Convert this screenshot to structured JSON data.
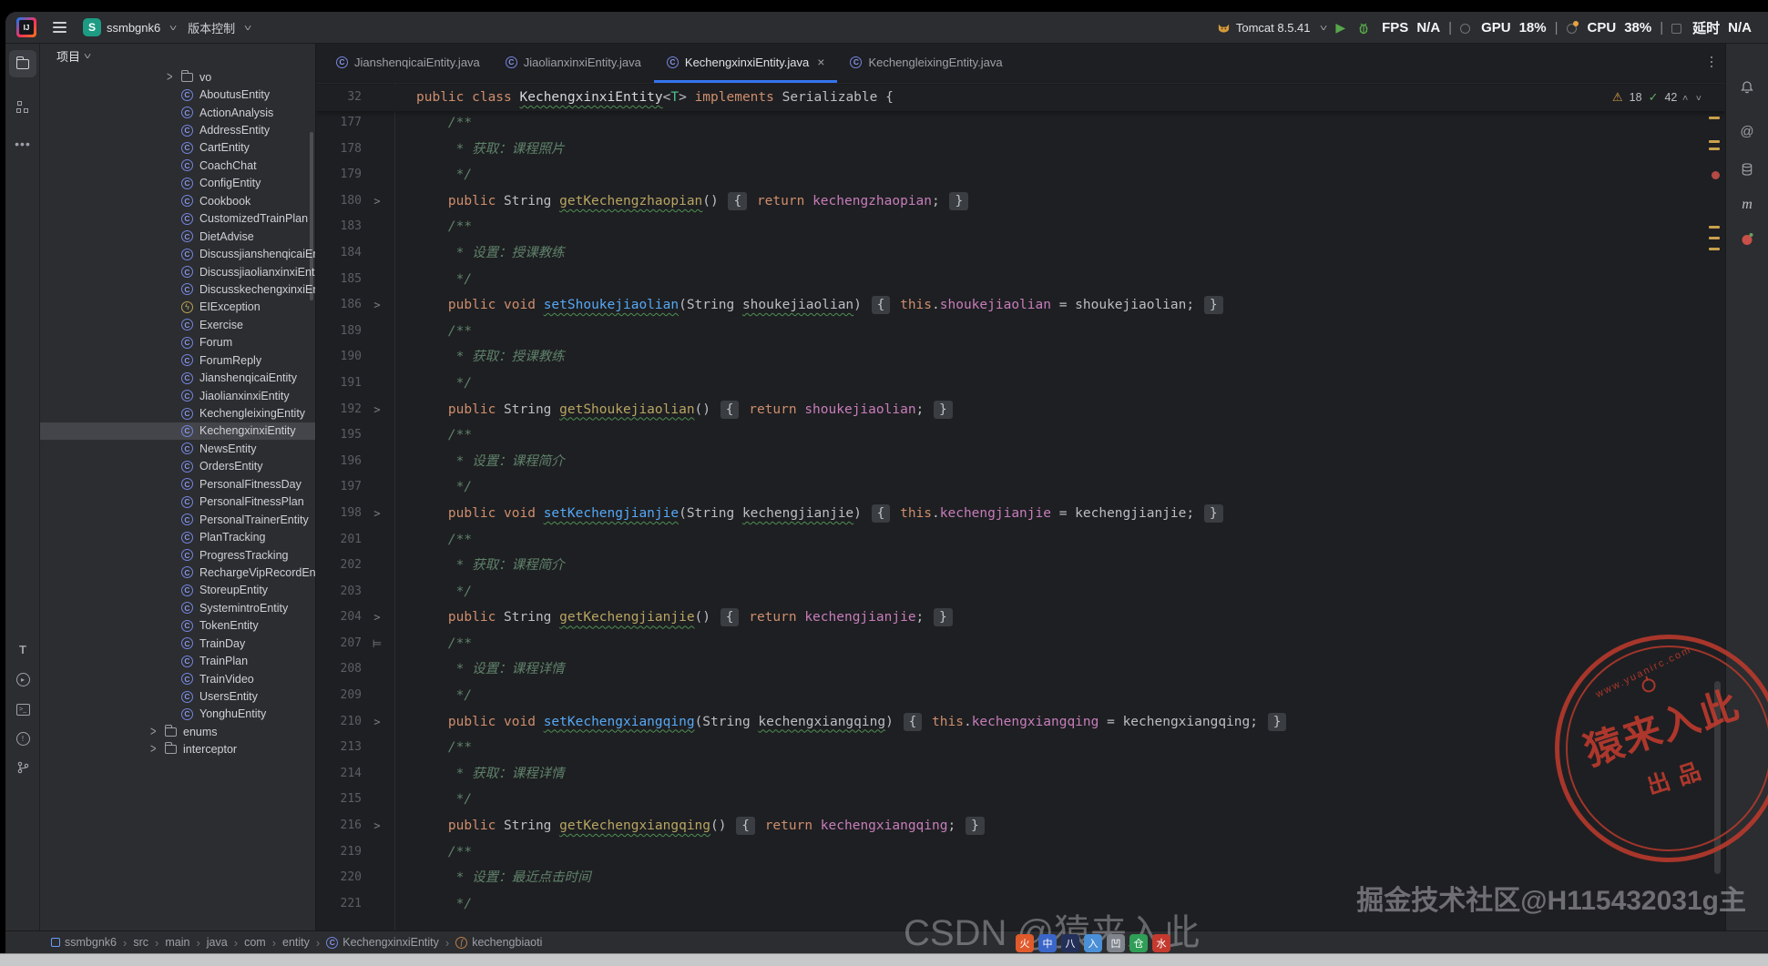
{
  "toolbar": {
    "app": "IntelliJ IDEA",
    "logo_text": "IJ",
    "project_avatar": "S",
    "project_name": "ssmbgnk6",
    "vcs_menu": "版本控制",
    "run_config": "Tomcat 8.5.41",
    "overlay_stats": [
      {
        "label": "FPS",
        "value": "N/A",
        "icon": ""
      },
      {
        "label": "GPU",
        "value": "18%",
        "icon": "person-icon"
      },
      {
        "label": "CPU",
        "value": "38%",
        "icon": "gear-icon"
      },
      {
        "label": "延时",
        "value": "N/A",
        "icon": "window-icon"
      }
    ]
  },
  "project_panel": {
    "header": "项目",
    "selected_item": "KechengxinxiEntity",
    "items": [
      {
        "label": "vo",
        "kind": "folder",
        "depth": 2,
        "chevron": true
      },
      {
        "label": "AboutusEntity",
        "kind": "class"
      },
      {
        "label": "ActionAnalysis",
        "kind": "class"
      },
      {
        "label": "AddressEntity",
        "kind": "class"
      },
      {
        "label": "CartEntity",
        "kind": "class"
      },
      {
        "label": "CoachChat",
        "kind": "class"
      },
      {
        "label": "ConfigEntity",
        "kind": "class"
      },
      {
        "label": "Cookbook",
        "kind": "class"
      },
      {
        "label": "CustomizedTrainPlan",
        "kind": "class"
      },
      {
        "label": "DietAdvise",
        "kind": "class"
      },
      {
        "label": "DiscussjianshenqicaiEntity",
        "kind": "class"
      },
      {
        "label": "DiscussjiaolianxinxiEntity",
        "kind": "class"
      },
      {
        "label": "DiscusskechengxinxiEntity",
        "kind": "class"
      },
      {
        "label": "EIException",
        "kind": "exception"
      },
      {
        "label": "Exercise",
        "kind": "class"
      },
      {
        "label": "Forum",
        "kind": "class"
      },
      {
        "label": "ForumReply",
        "kind": "class"
      },
      {
        "label": "JianshenqicaiEntity",
        "kind": "class"
      },
      {
        "label": "JiaolianxinxiEntity",
        "kind": "class"
      },
      {
        "label": "KechengleixingEntity",
        "kind": "class"
      },
      {
        "label": "KechengxinxiEntity",
        "kind": "class"
      },
      {
        "label": "NewsEntity",
        "kind": "class"
      },
      {
        "label": "OrdersEntity",
        "kind": "class"
      },
      {
        "label": "PersonalFitnessDay",
        "kind": "class"
      },
      {
        "label": "PersonalFitnessPlan",
        "kind": "class"
      },
      {
        "label": "PersonalTrainerEntity",
        "kind": "class"
      },
      {
        "label": "PlanTracking",
        "kind": "class"
      },
      {
        "label": "ProgressTracking",
        "kind": "class"
      },
      {
        "label": "RechargeVipRecordEntity",
        "kind": "class"
      },
      {
        "label": "StoreupEntity",
        "kind": "class"
      },
      {
        "label": "SystemintroEntity",
        "kind": "class"
      },
      {
        "label": "TokenEntity",
        "kind": "class"
      },
      {
        "label": "TrainDay",
        "kind": "class"
      },
      {
        "label": "TrainPlan",
        "kind": "class"
      },
      {
        "label": "TrainVideo",
        "kind": "class"
      },
      {
        "label": "UsersEntity",
        "kind": "class"
      },
      {
        "label": "YonghuEntity",
        "kind": "class"
      },
      {
        "label": "enums",
        "kind": "folder",
        "depth": 1,
        "chevron": true
      },
      {
        "label": "interceptor",
        "kind": "folder",
        "depth": 1,
        "chevron": true
      }
    ]
  },
  "tabs": [
    {
      "label": "JianshenqicaiEntity.java",
      "active": false
    },
    {
      "label": "JiaolianxinxiEntity.java",
      "active": false
    },
    {
      "label": "KechengxinxiEntity.java",
      "active": true,
      "close": "×"
    },
    {
      "label": "KechengleixingEntity.java",
      "active": false
    }
  ],
  "editor": {
    "inspections": {
      "warnings": "18",
      "typos": "42"
    },
    "sticky_line": {
      "n": "32",
      "g": "",
      "s": [
        [
          "k",
          "public class "
        ],
        [
          "wv",
          "KechengxinxiEntity"
        ],
        [
          "t",
          "<"
        ],
        [
          "tp",
          "T"
        ],
        [
          "t",
          "> "
        ],
        [
          "k",
          "implements "
        ],
        [
          "t",
          "Serializable {"
        ]
      ]
    },
    "lines": [
      {
        "n": "177",
        "g": "",
        "s": [
          [
            "c",
            "    /**"
          ]
        ]
      },
      {
        "n": "178",
        "g": "",
        "s": [
          [
            "c",
            "     * 获取：课程照片"
          ]
        ]
      },
      {
        "n": "179",
        "g": "",
        "s": [
          [
            "c",
            "     */"
          ]
        ]
      },
      {
        "n": "180",
        "g": "fold",
        "s": [
          [
            "t",
            "    "
          ],
          [
            "k",
            "public "
          ],
          [
            "t",
            "String "
          ],
          [
            "mg",
            "getKechengzhaopian"
          ],
          [
            "t",
            "() "
          ],
          [
            "fb",
            "{"
          ],
          [
            "t",
            " "
          ],
          [
            "k",
            "return "
          ],
          [
            "f",
            "kechengzhaopian"
          ],
          [
            "t",
            "; "
          ],
          [
            "fb",
            "}"
          ]
        ]
      },
      {
        "n": "183",
        "g": "",
        "s": [
          [
            "c",
            "    /**"
          ]
        ]
      },
      {
        "n": "184",
        "g": "",
        "s": [
          [
            "c",
            "     * 设置：授课教练"
          ]
        ]
      },
      {
        "n": "185",
        "g": "",
        "s": [
          [
            "c",
            "     */"
          ]
        ]
      },
      {
        "n": "186",
        "g": "fold",
        "s": [
          [
            "t",
            "    "
          ],
          [
            "k",
            "public void "
          ],
          [
            "ms",
            "setShoukejiaolian"
          ],
          [
            "t",
            "(String "
          ],
          [
            "pu",
            "shoukejiaolian"
          ],
          [
            "t",
            ") "
          ],
          [
            "fb",
            "{"
          ],
          [
            "t",
            " "
          ],
          [
            "k",
            "this"
          ],
          [
            "t",
            "."
          ],
          [
            "f",
            "shoukejiaolian"
          ],
          [
            "t",
            " = shoukejiaolian; "
          ],
          [
            "fb",
            "}"
          ]
        ]
      },
      {
        "n": "189",
        "g": "",
        "s": [
          [
            "c",
            "    /**"
          ]
        ]
      },
      {
        "n": "190",
        "g": "",
        "s": [
          [
            "c",
            "     * 获取：授课教练"
          ]
        ]
      },
      {
        "n": "191",
        "g": "",
        "s": [
          [
            "c",
            "     */"
          ]
        ]
      },
      {
        "n": "192",
        "g": "fold",
        "s": [
          [
            "t",
            "    "
          ],
          [
            "k",
            "public "
          ],
          [
            "t",
            "String "
          ],
          [
            "mg",
            "getShoukejiaolian"
          ],
          [
            "t",
            "() "
          ],
          [
            "fb",
            "{"
          ],
          [
            "t",
            " "
          ],
          [
            "k",
            "return "
          ],
          [
            "f",
            "shoukejiaolian"
          ],
          [
            "t",
            "; "
          ],
          [
            "fb",
            "}"
          ]
        ]
      },
      {
        "n": "195",
        "g": "",
        "s": [
          [
            "c",
            "    /**"
          ]
        ]
      },
      {
        "n": "196",
        "g": "",
        "s": [
          [
            "c",
            "     * 设置：课程简介"
          ]
        ]
      },
      {
        "n": "197",
        "g": "",
        "s": [
          [
            "c",
            "     */"
          ]
        ]
      },
      {
        "n": "198",
        "g": "fold",
        "s": [
          [
            "t",
            "    "
          ],
          [
            "k",
            "public void "
          ],
          [
            "ms",
            "setKechengjianjie"
          ],
          [
            "t",
            "(String "
          ],
          [
            "pu",
            "kechengjianjie"
          ],
          [
            "t",
            ") "
          ],
          [
            "fb",
            "{"
          ],
          [
            "t",
            " "
          ],
          [
            "k",
            "this"
          ],
          [
            "t",
            "."
          ],
          [
            "f",
            "kechengjianjie"
          ],
          [
            "t",
            " = kechengjianjie; "
          ],
          [
            "fb",
            "}"
          ]
        ]
      },
      {
        "n": "201",
        "g": "",
        "s": [
          [
            "c",
            "    /**"
          ]
        ]
      },
      {
        "n": "202",
        "g": "",
        "s": [
          [
            "c",
            "     * 获取：课程简介"
          ]
        ]
      },
      {
        "n": "203",
        "g": "",
        "s": [
          [
            "c",
            "     */"
          ]
        ]
      },
      {
        "n": "204",
        "g": "fold",
        "s": [
          [
            "t",
            "    "
          ],
          [
            "k",
            "public "
          ],
          [
            "t",
            "String "
          ],
          [
            "mg",
            "getKechengjianjie"
          ],
          [
            "t",
            "() "
          ],
          [
            "fb",
            "{"
          ],
          [
            "t",
            " "
          ],
          [
            "k",
            "return "
          ],
          [
            "f",
            "kechengjianjie"
          ],
          [
            "t",
            "; "
          ],
          [
            "fb",
            "}"
          ]
        ]
      },
      {
        "n": "207",
        "g": "mark",
        "s": [
          [
            "c",
            "    /**"
          ]
        ]
      },
      {
        "n": "208",
        "g": "",
        "s": [
          [
            "c",
            "     * 设置：课程详情"
          ]
        ]
      },
      {
        "n": "209",
        "g": "",
        "s": [
          [
            "c",
            "     */"
          ]
        ]
      },
      {
        "n": "210",
        "g": "fold",
        "s": [
          [
            "t",
            "    "
          ],
          [
            "k",
            "public void "
          ],
          [
            "ms",
            "setKechengxiangqing"
          ],
          [
            "t",
            "(String "
          ],
          [
            "pu",
            "kechengxiangqing"
          ],
          [
            "t",
            ") "
          ],
          [
            "fb",
            "{"
          ],
          [
            "t",
            " "
          ],
          [
            "k",
            "this"
          ],
          [
            "t",
            "."
          ],
          [
            "f",
            "kechengxiangqing"
          ],
          [
            "t",
            " = kechengxiangqing; "
          ],
          [
            "fb",
            "}"
          ]
        ]
      },
      {
        "n": "213",
        "g": "",
        "s": [
          [
            "c",
            "    /**"
          ]
        ]
      },
      {
        "n": "214",
        "g": "",
        "s": [
          [
            "c",
            "     * 获取：课程详情"
          ]
        ]
      },
      {
        "n": "215",
        "g": "",
        "s": [
          [
            "c",
            "     */"
          ]
        ]
      },
      {
        "n": "216",
        "g": "fold",
        "s": [
          [
            "t",
            "    "
          ],
          [
            "k",
            "public "
          ],
          [
            "t",
            "String "
          ],
          [
            "mg",
            "getKechengxiangqing"
          ],
          [
            "t",
            "() "
          ],
          [
            "fb",
            "{"
          ],
          [
            "t",
            " "
          ],
          [
            "k",
            "return "
          ],
          [
            "f",
            "kechengxiangqing"
          ],
          [
            "t",
            "; "
          ],
          [
            "fb",
            "}"
          ]
        ]
      },
      {
        "n": "219",
        "g": "",
        "s": [
          [
            "c",
            "    /**"
          ]
        ]
      },
      {
        "n": "220",
        "g": "",
        "s": [
          [
            "c",
            "     * 设置：最近点击时间"
          ]
        ]
      },
      {
        "n": "221",
        "g": "",
        "s": [
          [
            "c",
            "     */"
          ]
        ]
      }
    ]
  },
  "breadcrumbs": [
    {
      "label": "ssmbgnk6",
      "icon": "module"
    },
    {
      "label": "src"
    },
    {
      "label": "main"
    },
    {
      "label": "java"
    },
    {
      "label": "com"
    },
    {
      "label": "entity"
    },
    {
      "label": "KechengxinxiEntity",
      "icon": "class"
    },
    {
      "label": "kechengbiaoti",
      "icon": "field"
    }
  ],
  "watermarks": {
    "stamp": {
      "site": "www.yuanirc.com",
      "title": "猿来入此",
      "subtitle": "出品"
    },
    "line1": "掘金技术社区@H115432031g主",
    "line2": "CSDN @猿来入此",
    "chips": [
      {
        "bg": "#E05A2B",
        "t": "火"
      },
      {
        "bg": "#3A66C9",
        "t": "中"
      },
      {
        "bg": "#23305A",
        "t": "八"
      },
      {
        "bg": "#4B8FD6",
        "t": "入"
      },
      {
        "bg": "#7E838C",
        "t": "凹"
      },
      {
        "bg": "#2F9E57",
        "t": "仓"
      },
      {
        "bg": "#C43A2E",
        "t": "水"
      }
    ]
  },
  "colors": {
    "editor_bg": "#1E1F22",
    "panel_bg": "#2B2D30",
    "selection": "#43454A",
    "accent_tab": "#3574F0",
    "keyword": "#CF8E6D",
    "field": "#C77DBB",
    "method_setter": "#56A8F5",
    "method_getter": "#B8A562",
    "comment": "#5F826B",
    "warning": "#D9A343",
    "typo_ok": "#5FAD65",
    "stamp_red": "#C13B2D"
  }
}
